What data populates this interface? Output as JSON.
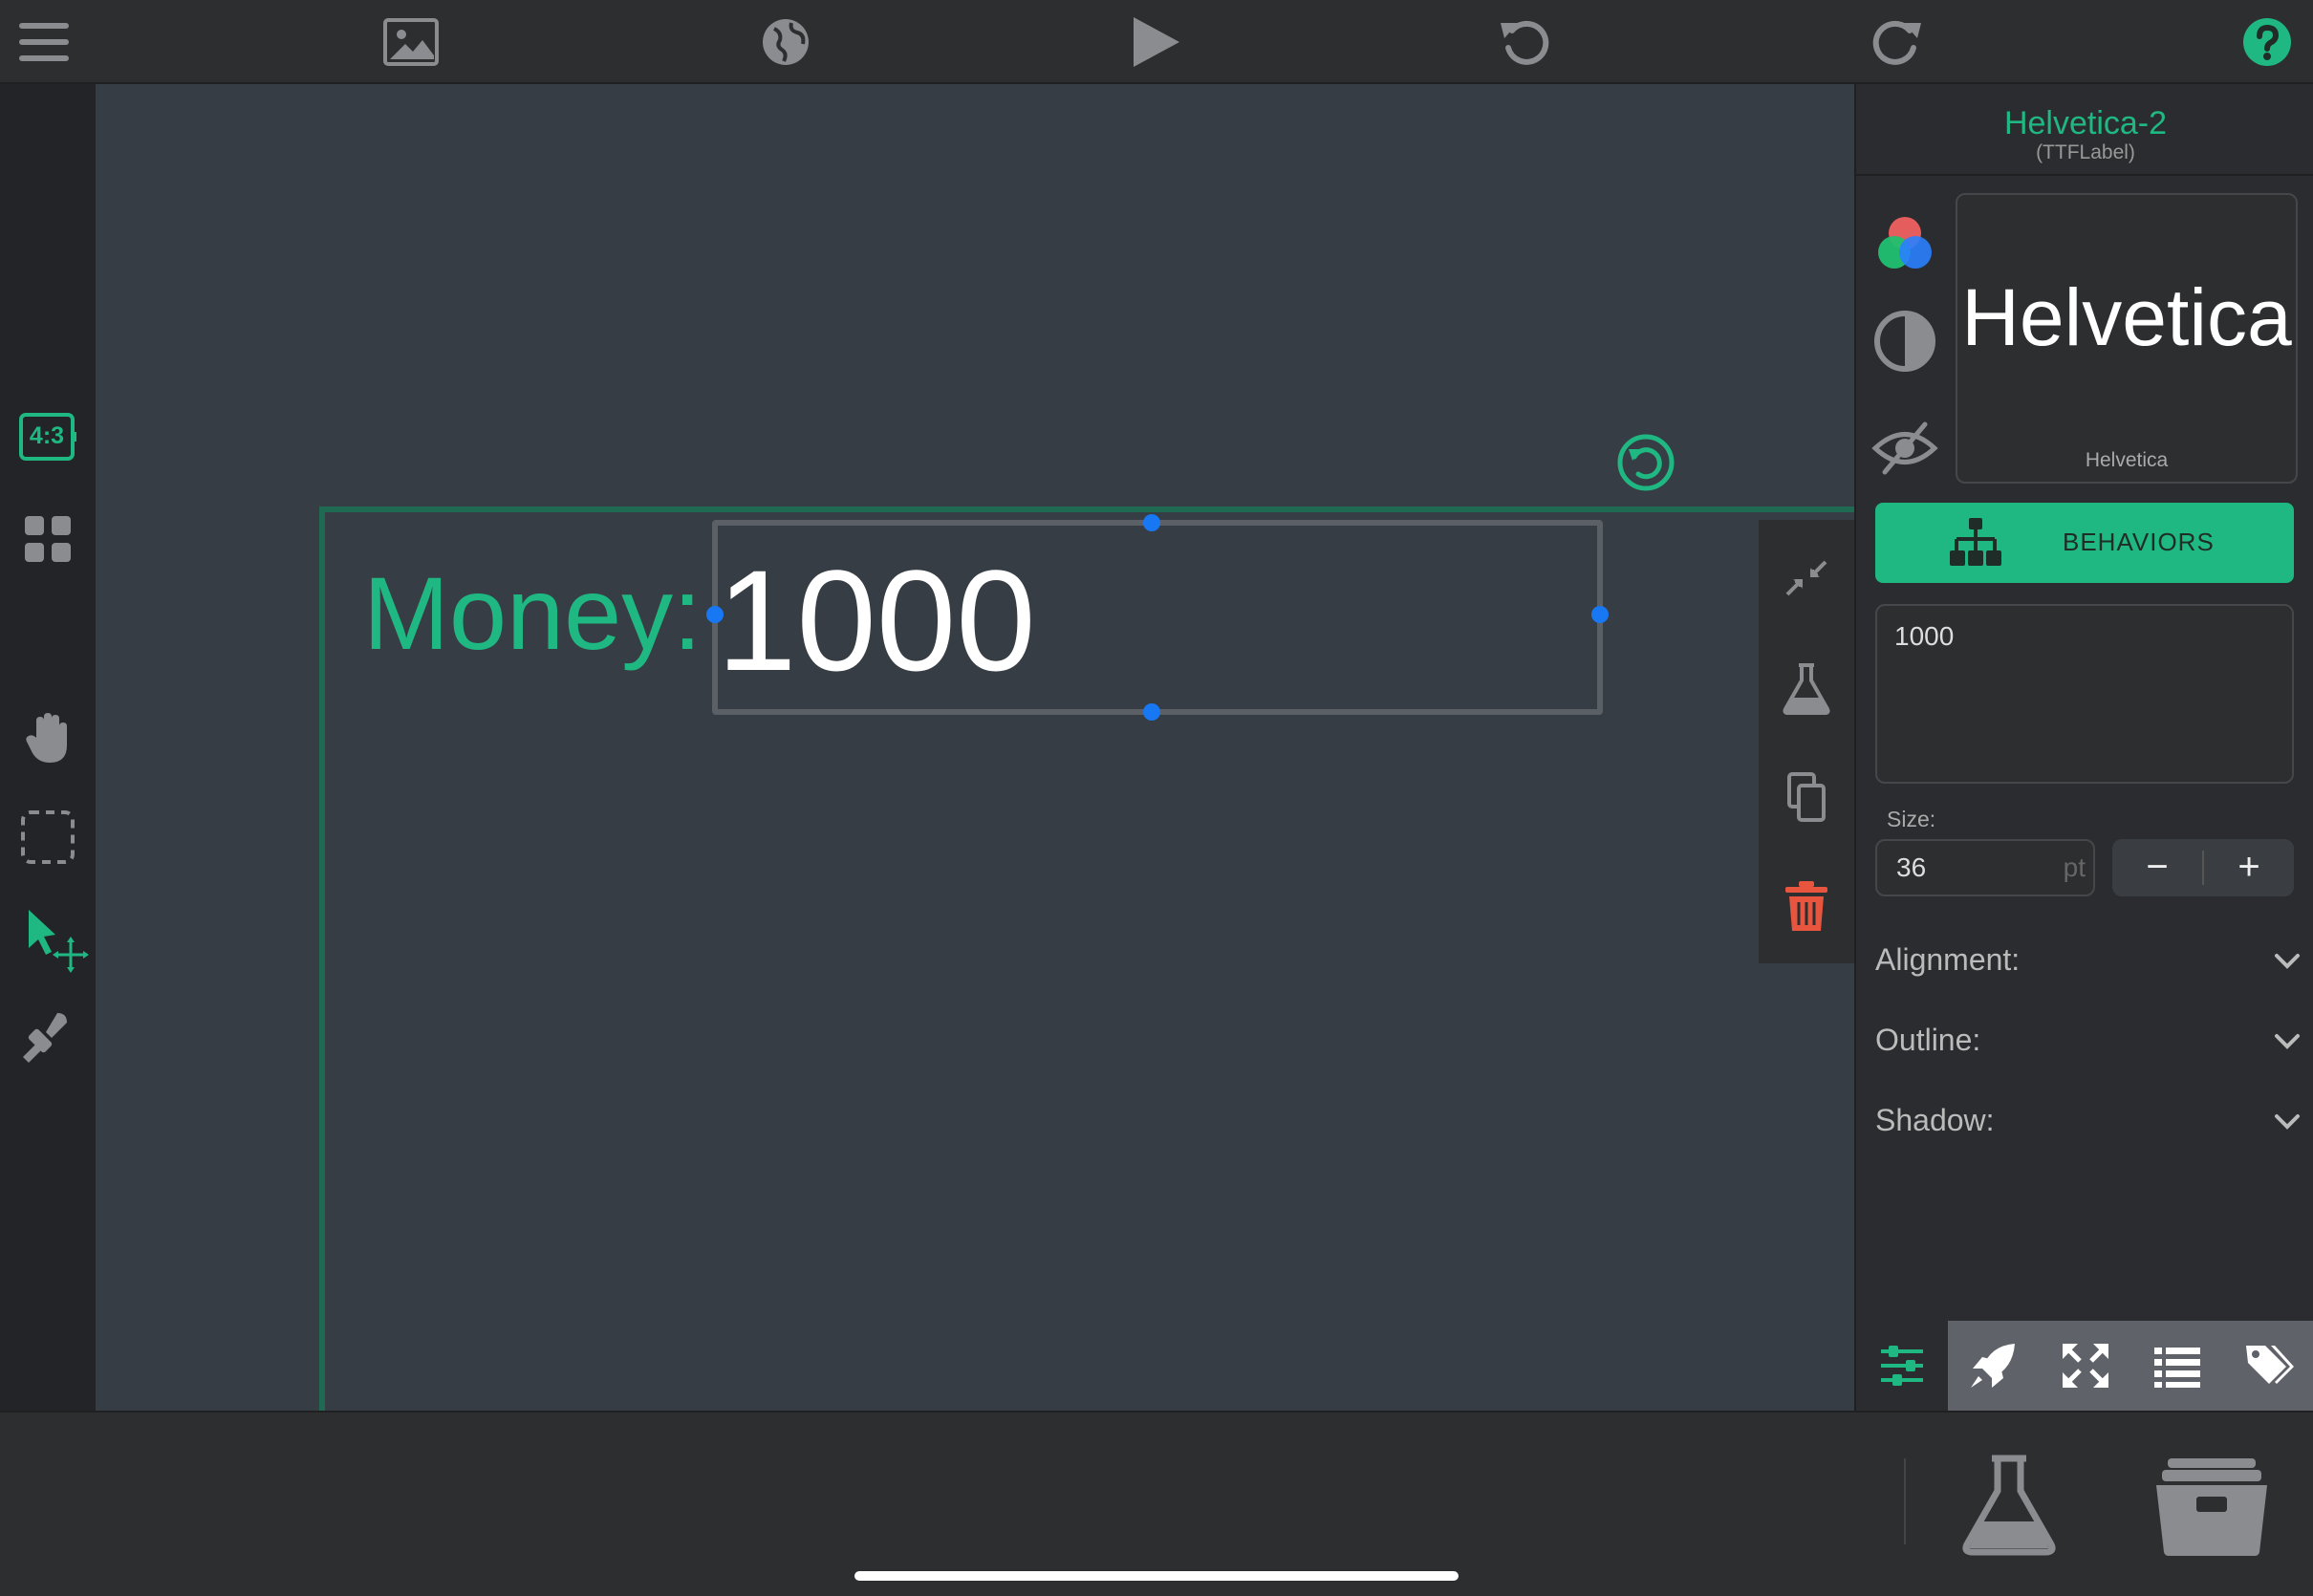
{
  "topbar": {
    "icons": [
      "menu-icon",
      "image-icon",
      "globe-icon",
      "play-icon",
      "undo-icon",
      "redo-icon",
      "help-icon"
    ],
    "accent": "#1fb882"
  },
  "lefttools": {
    "aspect_ratio": "4:3"
  },
  "scene": {
    "money_label": "Money:",
    "value_label": "1000"
  },
  "panel": {
    "object_name": "Helvetica-2",
    "object_type": "(TTFLabel)",
    "font_preview_large": "Helvetica",
    "font_preview_name": "Helvetica",
    "behaviors_label": "BEHAVIORS",
    "text_value": "1000",
    "size_caption": "Size:",
    "size_value": "36",
    "size_unit": "pt",
    "minus": "−",
    "plus": "+",
    "sections": [
      {
        "label": "Alignment:"
      },
      {
        "label": "Outline:"
      },
      {
        "label": "Shadow:"
      }
    ]
  },
  "colors": {
    "accent": "#1fb882",
    "delete": "#e8553f",
    "handle": "#1877f2",
    "canvas": "#373d44"
  }
}
